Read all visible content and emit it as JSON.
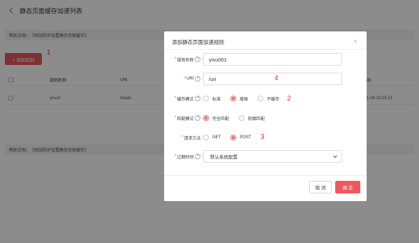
{
  "page": {
    "title": "静态页面缓存加速列表",
    "help_prefix": "帮助文档：",
    "help_link": "《网站防护设置静态页面缓存》",
    "add_button": "+ 添加规则",
    "table_headers": [
      "规则名称",
      "URI",
      "",
      "",
      "",
      "",
      "间"
    ],
    "table_row": [
      "yisusf",
      "/baidu",
      "",
      "",
      "",
      "",
      "1-08 18:25:21"
    ]
  },
  "annotations": [
    "1",
    "2",
    "3",
    "4"
  ],
  "modal": {
    "title": "添加静态页面加速规则",
    "close_icon": "×",
    "fields": {
      "rule_name": {
        "label": "规则名称",
        "value": "yisu001"
      },
      "uri": {
        "label": "URI",
        "value": "/uri"
      },
      "cache_mode": {
        "label": "缓存模式",
        "options": [
          "标准",
          "增强",
          "不缓存"
        ],
        "selected": "增强"
      },
      "match_mode": {
        "label": "匹配模式",
        "options": [
          "完全匹配",
          "前缀匹配"
        ],
        "selected": "完全匹配"
      },
      "request_method": {
        "label": "请求方法",
        "options": [
          "GET",
          "POST"
        ],
        "selected": "POST"
      },
      "expire_time": {
        "label": "过期时间",
        "value": "默认系统配置"
      }
    },
    "required_mark": "*",
    "help_icon_glyph": "?",
    "cancel_label": "取 消",
    "ok_label": "确 定"
  },
  "colors": {
    "accent": "#e8585d",
    "annotation": "#e53935"
  }
}
